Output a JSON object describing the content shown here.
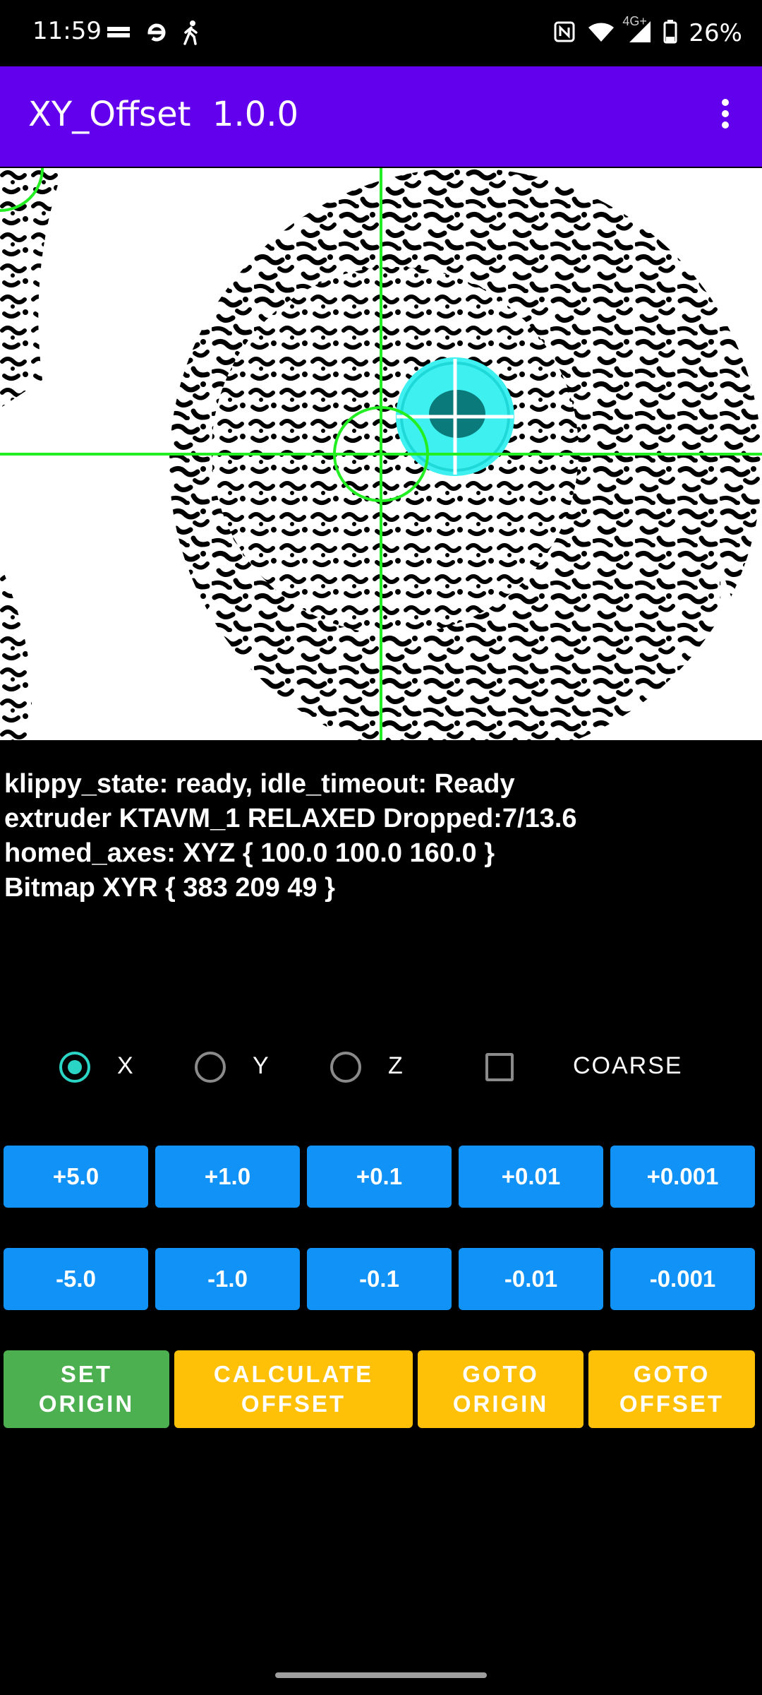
{
  "status_bar": {
    "time": "11:59",
    "left_icons": [
      "twente-milieu-logo",
      "e-logo-icon",
      "walking-person-icon"
    ],
    "right_icons": [
      "nfc-icon",
      "wifi-icon",
      "signal-4g-icon",
      "battery-icon"
    ],
    "network_label": "4G+",
    "battery": "26%"
  },
  "app_bar": {
    "title": "XY_Offset  1.0.0",
    "menu_icon": "more-vert-icon",
    "color": "#6200ee"
  },
  "status_lines": [
    "klippy_state: ready, idle_timeout: Ready",
    "extruder KTAVM_1 RELAXED Dropped:7/13.6",
    "homed_axes: XYZ { 100.0 100.0 160.0 }",
    "Bitmap XYR { 383 209 49 }"
  ],
  "axis_selector": {
    "options": [
      {
        "label": "X",
        "checked": true
      },
      {
        "label": "Y",
        "checked": false
      },
      {
        "label": "Z",
        "checked": false
      }
    ],
    "coarse": {
      "label": "COARSE",
      "checked": false
    }
  },
  "increment_buttons": [
    "+5.0",
    "+1.0",
    "+0.1",
    "+0.01",
    "+0.001"
  ],
  "decrement_buttons": [
    "-5.0",
    "-1.0",
    "-0.1",
    "-0.01",
    "-0.001"
  ],
  "action_buttons": {
    "set_origin": "SET\nORIGIN",
    "calculate_offset": "CALCULATE\nOFFSET",
    "goto_origin": "GOTO\nORIGIN",
    "goto_offset": "GOTO\nOFFSET"
  },
  "colors": {
    "step_button": "#1192f6",
    "set_origin": "#4caf50",
    "action": "#ffc107",
    "crosshair": "#22ee22",
    "detected_circle": "#3ff0f0",
    "radio_accent": "#2bd5c6"
  }
}
